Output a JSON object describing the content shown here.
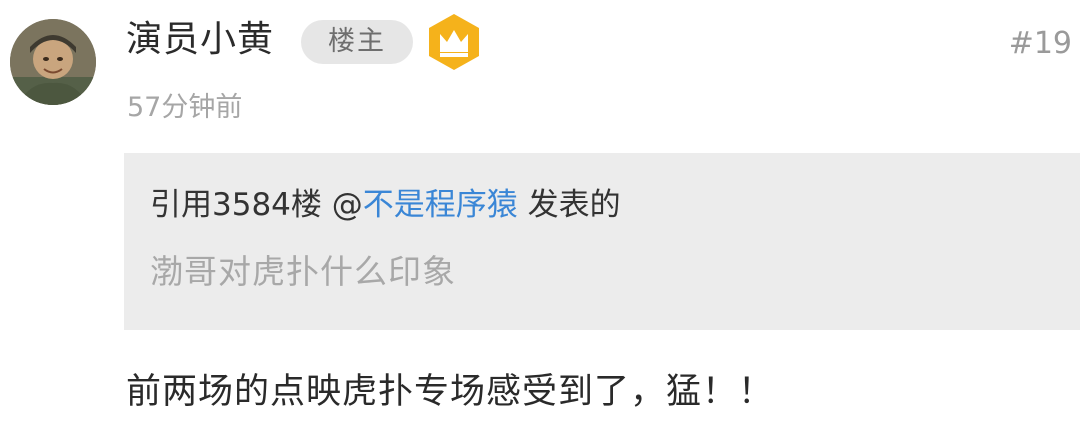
{
  "post": {
    "username": "演员小黄",
    "op_badge": "楼主",
    "floor": "#19",
    "timestamp": "57分钟前",
    "avatar_icon": "user-avatar-icon",
    "vip_badge_icon": "crown-icon",
    "quote": {
      "prefix": "引用3584楼 @",
      "mention": "不是程序猿",
      "suffix": " 发表的",
      "text": "渤哥对虎扑什么印象"
    },
    "content": "前两场的点映虎扑专场感受到了，猛！！"
  },
  "colors": {
    "mention": "#3a86d6",
    "badge_bg": "#e6e6e6",
    "crown_gold": "#f5b21b",
    "quote_bg": "#ececec"
  }
}
